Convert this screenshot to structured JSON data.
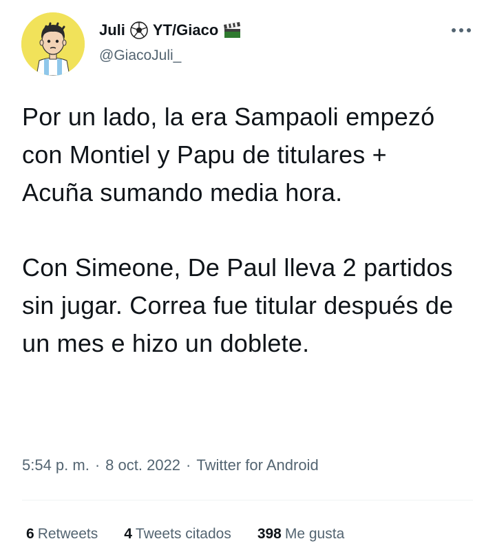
{
  "author": {
    "display_name_part1": "Juli",
    "display_name_part2": "YT/Giaco",
    "handle": "@GiacoJuli_",
    "name_emoji_1": "soccer-ball-icon",
    "name_emoji_2": "clapper-board-icon"
  },
  "menu": {
    "more_icon": "more-dots-icon"
  },
  "tweet": {
    "paragraph_1": "Por un lado, la era Sampaoli empezó con Montiel y Papu de titulares + Acuña sumando media hora.",
    "paragraph_2": "Con Simeone, De Paul lleva 2 partidos sin jugar. Correa fue titular después de un mes e hizo un doblete."
  },
  "meta": {
    "time": "5:54 p. m.",
    "separator": "·",
    "date": "8 oct. 2022",
    "source": "Twitter for Android"
  },
  "stats": {
    "retweets_count": "6",
    "retweets_label": "Retweets",
    "quotes_count": "4",
    "quotes_label": "Tweets citados",
    "likes_count": "398",
    "likes_label": "Me gusta"
  },
  "colors": {
    "text_primary": "#0f1419",
    "text_secondary": "#536471",
    "divider": "#eff3f4",
    "avatar_bg": "#f1e25a"
  }
}
